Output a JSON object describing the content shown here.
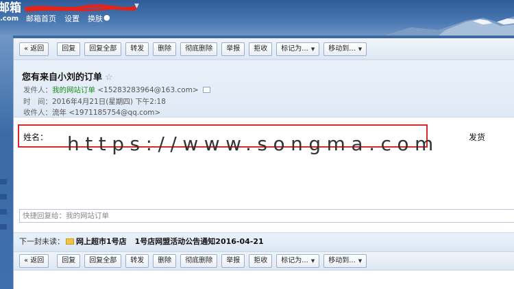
{
  "header": {
    "logo_text": "邮箱",
    "logo_sub": ".com",
    "account_arrow": "▼",
    "nav": [
      {
        "label": "邮箱首页"
      },
      {
        "label": "设置"
      },
      {
        "label": "换肤"
      }
    ]
  },
  "toolbar": {
    "buttons": [
      {
        "label": "« 返回"
      },
      {
        "label": "回复"
      },
      {
        "label": "回复全部"
      },
      {
        "label": "转发"
      },
      {
        "label": "删除"
      },
      {
        "label": "彻底删除"
      },
      {
        "label": "举报"
      },
      {
        "label": "拒收"
      },
      {
        "label": "标记为..."
      },
      {
        "label": "移动到..."
      }
    ]
  },
  "mail": {
    "subject": "您有来自小刘的订单",
    "star": "☆",
    "from_label": "发件人：",
    "from_name": "我的网站订单",
    "from_email": "<15283283964@163.com>",
    "time_label": "时　间：",
    "time_value": "2016年4月21日(星期四) 下午2:18",
    "to_label": "收件人：",
    "to_name": "流年",
    "to_email": "<1971185754@qq.com>",
    "body_name_label": "姓名：",
    "watermark": "https://www.songma.com",
    "trailing_text": "发货"
  },
  "quick_reply": {
    "placeholder": "快捷回复给：我的网站订单"
  },
  "next_mail": {
    "label": "下一封未读：",
    "sender": "网上超市1号店",
    "subject": "1号店网盟活动公告通知2016-04-21"
  },
  "colors": {
    "header_blue": "#3f6aa1",
    "sender_green": "#1a8f1a",
    "highlight_red": "#d9262a"
  }
}
